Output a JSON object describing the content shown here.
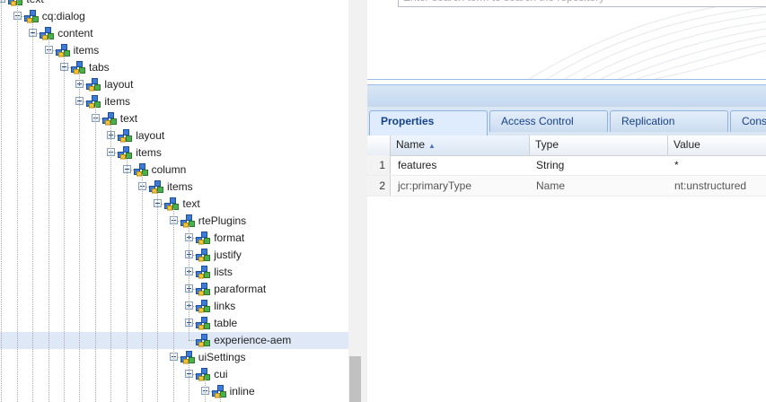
{
  "tree": {
    "nodes": [
      {
        "label": "text",
        "depth": 1,
        "state": "collapse"
      },
      {
        "label": "cq:dialog",
        "depth": 2,
        "state": "collapse"
      },
      {
        "label": "content",
        "depth": 3,
        "state": "collapse"
      },
      {
        "label": "items",
        "depth": 4,
        "state": "collapse"
      },
      {
        "label": "tabs",
        "depth": 5,
        "state": "collapse"
      },
      {
        "label": "layout",
        "depth": 6,
        "state": "expand"
      },
      {
        "label": "items",
        "depth": 6,
        "state": "collapse"
      },
      {
        "label": "text",
        "depth": 7,
        "state": "collapse"
      },
      {
        "label": "layout",
        "depth": 8,
        "state": "expand"
      },
      {
        "label": "items",
        "depth": 8,
        "state": "collapse"
      },
      {
        "label": "column",
        "depth": 9,
        "state": "collapse"
      },
      {
        "label": "items",
        "depth": 10,
        "state": "collapse"
      },
      {
        "label": "text",
        "depth": 11,
        "state": "collapse"
      },
      {
        "label": "rtePlugins",
        "depth": 12,
        "state": "collapse"
      },
      {
        "label": "format",
        "depth": 13,
        "state": "expand"
      },
      {
        "label": "justify",
        "depth": 13,
        "state": "expand"
      },
      {
        "label": "lists",
        "depth": 13,
        "state": "expand"
      },
      {
        "label": "paraformat",
        "depth": 13,
        "state": "expand"
      },
      {
        "label": "links",
        "depth": 13,
        "state": "expand"
      },
      {
        "label": "table",
        "depth": 13,
        "state": "expand"
      },
      {
        "label": "experience-aem",
        "depth": 13,
        "state": "leaf",
        "selected": true
      },
      {
        "label": "uiSettings",
        "depth": 12,
        "state": "collapse"
      },
      {
        "label": "cui",
        "depth": 13,
        "state": "collapse"
      },
      {
        "label": "inline",
        "depth": 14,
        "state": "collapse"
      },
      {
        "label": "",
        "depth": 15,
        "state": "leaf"
      }
    ]
  },
  "search": {
    "placeholder": "Enter search term to search the repository"
  },
  "tabs": [
    {
      "label": "Properties",
      "active": true
    },
    {
      "label": "Access Control",
      "active": false
    },
    {
      "label": "Replication",
      "active": false
    },
    {
      "label": "Console",
      "active": false
    }
  ],
  "grid": {
    "columns": [
      "Name",
      "Type",
      "Value"
    ],
    "sort_column": "Name",
    "rows": [
      {
        "num": "1",
        "name": "features",
        "type": "String",
        "value": "*"
      },
      {
        "num": "2",
        "name": "jcr:primaryType",
        "type": "Name",
        "value": "nt:unstructured"
      }
    ]
  },
  "colors": {
    "accent": "#15428b",
    "selected_row": "#dfe8f6",
    "panel_border": "#99bbe8"
  },
  "icons": {
    "node": "node-cube-icon",
    "expand": "plus-expander-icon",
    "collapse": "minus-expander-icon",
    "sort": "sort-ascending-icon"
  }
}
